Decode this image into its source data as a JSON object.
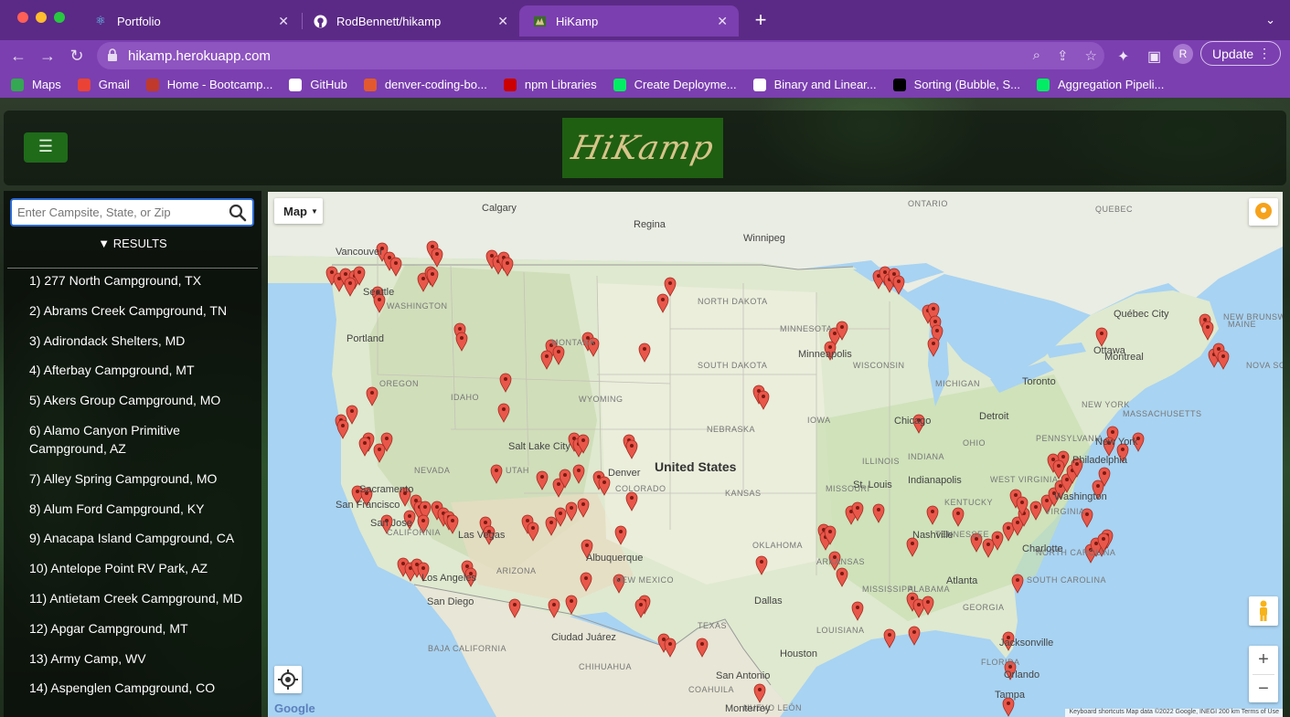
{
  "browser": {
    "tabs": [
      {
        "title": "Portfolio",
        "icon": "react-icon"
      },
      {
        "title": "RodBennett/hikamp",
        "icon": "github-icon"
      },
      {
        "title": "HiKamp",
        "icon": "hikamp-favicon"
      }
    ],
    "url": "hikamp.herokuapp.com",
    "profile_initial": "R",
    "update_label": "Update",
    "bookmarks": [
      {
        "label": "Maps",
        "color": "#34a853"
      },
      {
        "label": "Gmail",
        "color": "#ea4335"
      },
      {
        "label": "Home - Bootcamp...",
        "color": "#c0392b"
      },
      {
        "label": "GitHub",
        "color": "#ffffff"
      },
      {
        "label": "denver-coding-bo...",
        "color": "#e2592f"
      },
      {
        "label": "npm Libraries",
        "color": "#cb0000"
      },
      {
        "label": "Create Deployme...",
        "color": "#00ed64"
      },
      {
        "label": "Binary and Linear...",
        "color": "#ffffff"
      },
      {
        "label": "Sorting (Bubble, S...",
        "color": "#000000"
      },
      {
        "label": "Aggregation Pipeli...",
        "color": "#00ed64"
      }
    ]
  },
  "header": {
    "menu_icon": "hamburger-icon",
    "logo_text": "HiKamp",
    "accent": "#1f6b1a"
  },
  "sidebar": {
    "search_placeholder": "Enter Campsite, State, or Zip",
    "results_toggle": "▼ RESULTS",
    "results": [
      "1) 277 North Campground, TX",
      "2) Abrams Creek Campground, TN",
      "3) Adirondack Shelters, MD",
      "4) Afterbay Campground, MT",
      "5) Akers Group Campground, MO",
      "6) Alamo Canyon Primitive Campground, AZ",
      "7) Alley Spring Campground, MO",
      "8) Alum Ford Campground, KY",
      "9) Anacapa Island Campground, CA",
      "10) Antelope Point RV Park, AZ",
      "11) Antietam Creek Campground, MD",
      "12) Apgar Campground, MT",
      "13) Army Camp, WV",
      "14) Aspenglen Campground, CO"
    ]
  },
  "map": {
    "type_label": "Map",
    "google_logo": "Google",
    "attribution": "Keyboard shortcuts    Map data ©2022 Google, INEGI    200 km    Terms of Use",
    "country_label": "United States",
    "marker_color": "#e8574a",
    "labels": {
      "calgary": "Calgary",
      "regina": "Regina",
      "winnipeg": "Winnipeg",
      "ontario": "ONTARIO",
      "quebec": "QUEBEC",
      "vancouver": "Vancouver",
      "seattle": "Seattle",
      "washington": "WASHINGTON",
      "portland": "Portland",
      "oregon": "OREGON",
      "idaho": "IDAHO",
      "montana": "MONTANA",
      "wyoming": "WYOMING",
      "nevada": "NEVADA",
      "utah": "UTAH",
      "colorado": "COLORADO",
      "arizona": "ARIZONA",
      "new_mexico": "NEW MEXICO",
      "california": "CALIFORNIA",
      "north_dakota": "NORTH DAKOTA",
      "south_dakota": "SOUTH DAKOTA",
      "nebraska": "NEBRASKA",
      "kansas": "KANSAS",
      "oklahoma": "OKLAHOMA",
      "texas": "TEXAS",
      "minnesota": "MINNESOTA",
      "iowa": "IOWA",
      "missouri": "MISSOURI",
      "arkansas": "ARKANSAS",
      "louisiana": "LOUISIANA",
      "mississippi": "MISSISSIPPI",
      "alabama": "ALABAMA",
      "georgia": "GEORGIA",
      "florida": "FLORIDA",
      "wisconsin": "WISCONSIN",
      "michigan": "MICHIGAN",
      "illinois": "ILLINOIS",
      "indiana": "INDIANA",
      "ohio": "OHIO",
      "kentucky": "KENTUCKY",
      "tennessee": "TENNESSEE",
      "virginia": "VIRGINIA",
      "west_virginia": "WEST VIRGINIA",
      "north_carolina": "NORTH CAROLINA",
      "south_carolina": "SOUTH CAROLINA",
      "pennsylvania": "PENNSYLVANIA",
      "new_york": "NEW YORK",
      "maine": "MAINE",
      "new_brunswick": "NEW BRUNSWICK",
      "nova_scotia": "NOVA SCOTIA",
      "massachusetts": "MASSACHUSETTS",
      "quebec_city": "Québec City",
      "ottawa": "Ottawa",
      "montreal": "Montreal",
      "toronto": "Toronto",
      "minneapolis": "Minneapolis",
      "chicago": "Chicago",
      "detroit": "Detroit",
      "st_louis": "St. Louis",
      "indianapolis": "Indianapolis",
      "nashville": "Nashville",
      "atlanta": "Atlanta",
      "charlotte": "Charlotte",
      "washington_dc": "Washington",
      "philadelphia": "Philadelphia",
      "new_york_city": "New York",
      "jacksonville": "Jacksonville",
      "orlando": "Orlando",
      "tampa": "Tampa",
      "houston": "Houston",
      "san_antonio": "San Antonio",
      "dallas": "Dallas",
      "denver": "Denver",
      "salt_lake_city": "Salt Lake City",
      "las_vegas": "Las Vegas",
      "los_angeles": "Los Angeles",
      "san_diego": "San Diego",
      "san_francisco": "San Francisco",
      "sacramento": "Sacramento",
      "san_jose": "San Jose",
      "albuquerque": "Albuquerque",
      "ciudad_juarez": "Ciudad Juárez",
      "chihuahua": "CHIHUAHUA",
      "baja_california": "BAJA CALIFORNIA",
      "coahuila": "COAHUILA",
      "nuevo_leon": "NUEVO LEÓN",
      "monterrey": "Monterrey"
    }
  }
}
